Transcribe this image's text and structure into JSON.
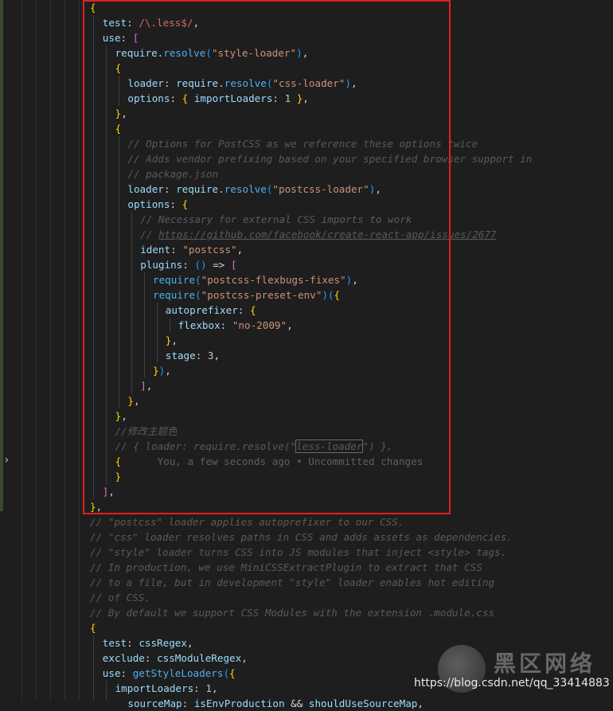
{
  "editor": {
    "blame_annotation": "You, a few seconds ago • Uncommitted changes",
    "lines": [
      "{",
      "test: /\\.less$/,",
      "use: [",
      "require.resolve(\"style-loader\"),",
      "{",
      "loader: require.resolve(\"css-loader\"),",
      "options: { importLoaders: 1 },",
      "},",
      "{",
      "// Options for PostCSS as we reference these options twice",
      "// Adds vendor prefixing based on your specified browser support in",
      "// package.json",
      "loader: require.resolve(\"postcss-loader\"),",
      "options: {",
      "// Necessary for external CSS imports to work",
      "// https://github.com/facebook/create-react-app/issues/2677",
      "ident: \"postcss\",",
      "plugins: () => [",
      "require(\"postcss-flexbugs-fixes\"),",
      "require(\"postcss-preset-env\")({",
      "autoprefixer: {",
      "flexbox: \"no-2009\",",
      "},",
      "stage: 3,",
      "}),",
      "],",
      "},",
      "},",
      "//修改主题色",
      "// { loader: require.resolve(\"less-loader\") },",
      "{",
      "}",
      "],",
      "},",
      "// \"postcss\" loader applies autoprefixer to our CSS.",
      "// \"css\" loader resolves paths in CSS and adds assets as dependencies.",
      "// \"style\" loader turns CSS into JS modules that inject <style> tags.",
      "// In production, we use MiniCSSExtractPlugin to extract that CSS",
      "// to a file, but in development \"style\" loader enables hot editing",
      "// of CSS.",
      "// By default we support CSS Modules with the extension .module.css",
      "{",
      "test: cssRegex,",
      "exclude: cssModuleRegex,",
      "use: getStyleLoaders({",
      "importLoaders: 1,",
      "sourceMap: isEnvProduction && shouldUseSourceMap,"
    ]
  },
  "watermark": {
    "site_name": "黑区网络",
    "url": "https://blog.csdn.net/qq_33414883"
  },
  "colors": {
    "highlight_border": "#e02020",
    "background": "#1e1e1e"
  }
}
